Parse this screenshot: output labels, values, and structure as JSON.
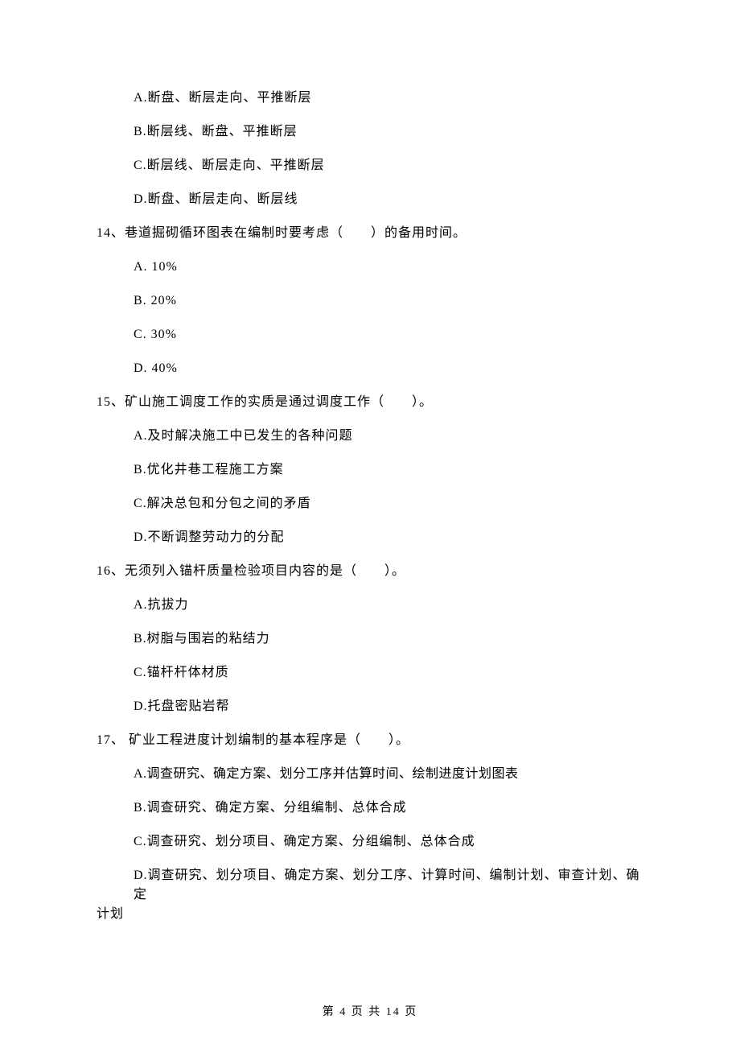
{
  "prev_options": {
    "a": "A.断盘、断层走向、平推断层",
    "b": "B.断层线、断盘、平推断层",
    "c": "C.断层线、断层走向、平推断层",
    "d": "D.断盘、断层走向、断层线"
  },
  "q14": {
    "text": "14、巷道掘砌循环图表在编制时要考虑（　　）的备用时间。",
    "a": "A.  10%",
    "b": "B.  20%",
    "c": "C.  30%",
    "d": "D.  40%"
  },
  "q15": {
    "text": "15、矿山施工调度工作的实质是通过调度工作（　　）。",
    "a": "A.及时解决施工中已发生的各种问题",
    "b": "B.优化井巷工程施工方案",
    "c": "C.解决总包和分包之间的矛盾",
    "d": "D.不断调整劳动力的分配"
  },
  "q16": {
    "text": "16、无须列入锚杆质量检验项目内容的是（　　）。",
    "a": "A.抗拔力",
    "b": "B.树脂与围岩的粘结力",
    "c": "C.锚杆杆体材质",
    "d": "D.托盘密贴岩帮"
  },
  "q17": {
    "text": "17、 矿业工程进度计划编制的基本程序是（　　）。",
    "a": "A.调查研究、确定方案、划分工序并估算时间、绘制进度计划图表",
    "b": "B.调查研究、确定方案、分组编制、总体合成",
    "c": "C.调查研究、划分项目、确定方案、分组编制、总体合成",
    "d1": "D.调查研究、划分项目、确定方案、划分工序、计算时间、编制计划、审查计划、确定",
    "d2": "计划"
  },
  "footer": "第 4 页 共 14 页"
}
